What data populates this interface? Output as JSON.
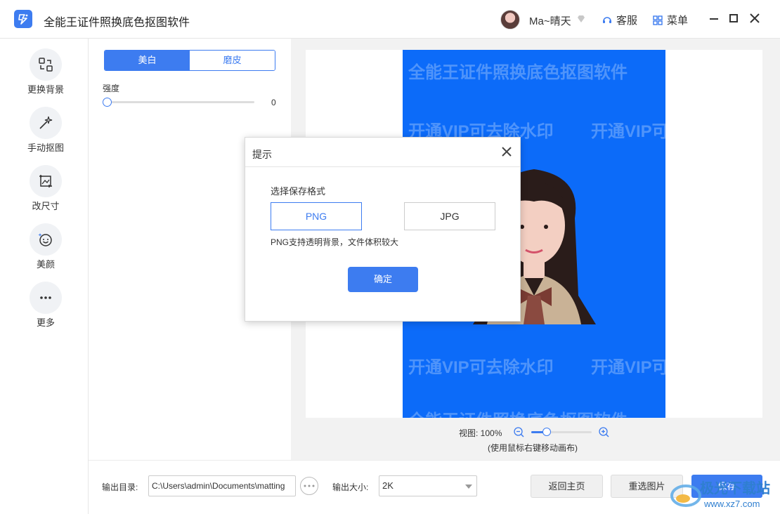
{
  "window": {
    "title": "全能王证件照换底色抠图软件",
    "username": "Ma~晴天",
    "service_label": "客服",
    "menu_label": "菜单"
  },
  "sidebar": {
    "items": [
      {
        "label": "更换背景",
        "icon": "swap-background-icon"
      },
      {
        "label": "手动抠图",
        "icon": "magic-wand-icon"
      },
      {
        "label": "改尺寸",
        "icon": "resize-icon"
      },
      {
        "label": "美颜",
        "icon": "face-smile-icon"
      },
      {
        "label": "更多",
        "icon": "more-dots-icon"
      }
    ]
  },
  "settings": {
    "tabs": [
      "美白",
      "磨皮"
    ],
    "active_tab": 0,
    "strength_label": "强度",
    "strength_value": "0"
  },
  "preview": {
    "watermark_title": "全能王证件照换底色抠图软件",
    "watermark_vip": "开通VIP可去除水印",
    "zoom_label": "视图: 100%",
    "zoom_value": 0.25,
    "zoom_hint": "(使用鼠标右键移动画布)",
    "background_color": "#0c6bf9"
  },
  "bottom": {
    "output_dir_label": "输出目录:",
    "output_dir_value": "C:\\Users\\admin\\Documents\\matting",
    "output_size_label": "输出大小:",
    "output_size_value": "2K",
    "back_home": "返回主页",
    "reselect": "重选图片",
    "save": "保存",
    "site_watermark": "极光下载站",
    "site_url": "www.xz7.com"
  },
  "dialog": {
    "title": "提示",
    "label": "选择保存格式",
    "formats": [
      "PNG",
      "JPG"
    ],
    "selected": "PNG",
    "note": "PNG支持透明背景，文件体积较大",
    "ok": "确定"
  },
  "colors": {
    "accent": "#3d7cf0"
  }
}
